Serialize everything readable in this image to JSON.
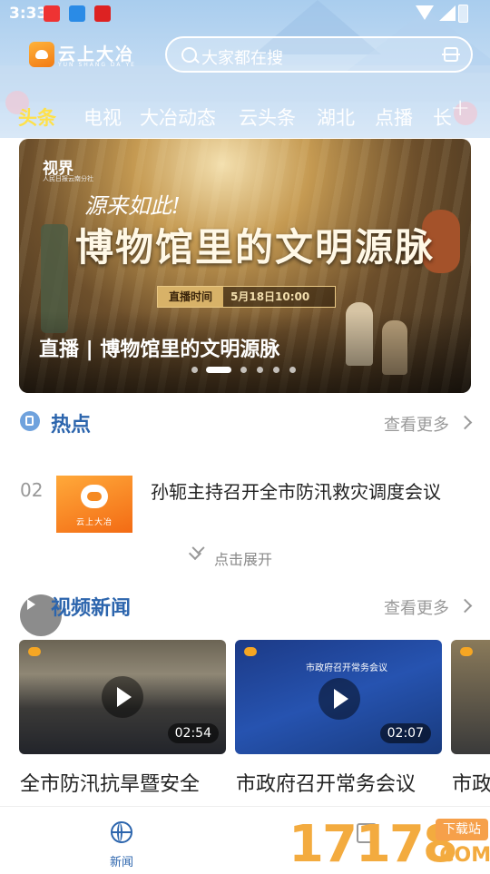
{
  "status_bar": {
    "time": "3:33"
  },
  "header": {
    "logo_text": "云上大冶",
    "logo_sub": "YUN SHANG DA YE",
    "search_placeholder": "大家都在搜"
  },
  "tabs": [
    {
      "label": "头条",
      "active": true
    },
    {
      "label": "电视"
    },
    {
      "label": "大冶动态"
    },
    {
      "label": "云头条"
    },
    {
      "label": "湖北"
    },
    {
      "label": "点播"
    },
    {
      "label": "长"
    }
  ],
  "banner": {
    "brand": "视界",
    "brand_sub": "人民日报云南分社",
    "tagline": "源来如此!",
    "headline": "博物馆里的文明源脉",
    "live_label": "直播时间",
    "live_time": "5月18日10:00",
    "caption": "直播 | 博物馆里的文明源脉",
    "dots": 6,
    "active_dot": 1
  },
  "hot_section": {
    "title": "热点",
    "more": "查看更多",
    "items": [
      {
        "rank": "02",
        "title": "孙轭主持召开全市防汛救灾调度会议",
        "thumb_text": "云上大冶"
      }
    ],
    "expand": "点击展开"
  },
  "video_section": {
    "title": "视频新闻",
    "more": "查看更多",
    "items": [
      {
        "title": "全市防汛抗旱暨安全",
        "duration": "02:54"
      },
      {
        "title": "市政府召开常务会议",
        "duration": "02:07",
        "thumb_headline": "市政府召开常务会议"
      },
      {
        "title": "市政"
      }
    ]
  },
  "bottom_nav": {
    "items": [
      {
        "label": "新闻",
        "active": true,
        "icon": "globe-icon"
      }
    ]
  },
  "watermark": {
    "number": "17178",
    "badge": "下载站",
    "suffix": ".COM"
  },
  "colors": {
    "brand_blue": "#2c65ad",
    "tab_active": "#ffe14a",
    "accent_orange": "#f27a14"
  }
}
